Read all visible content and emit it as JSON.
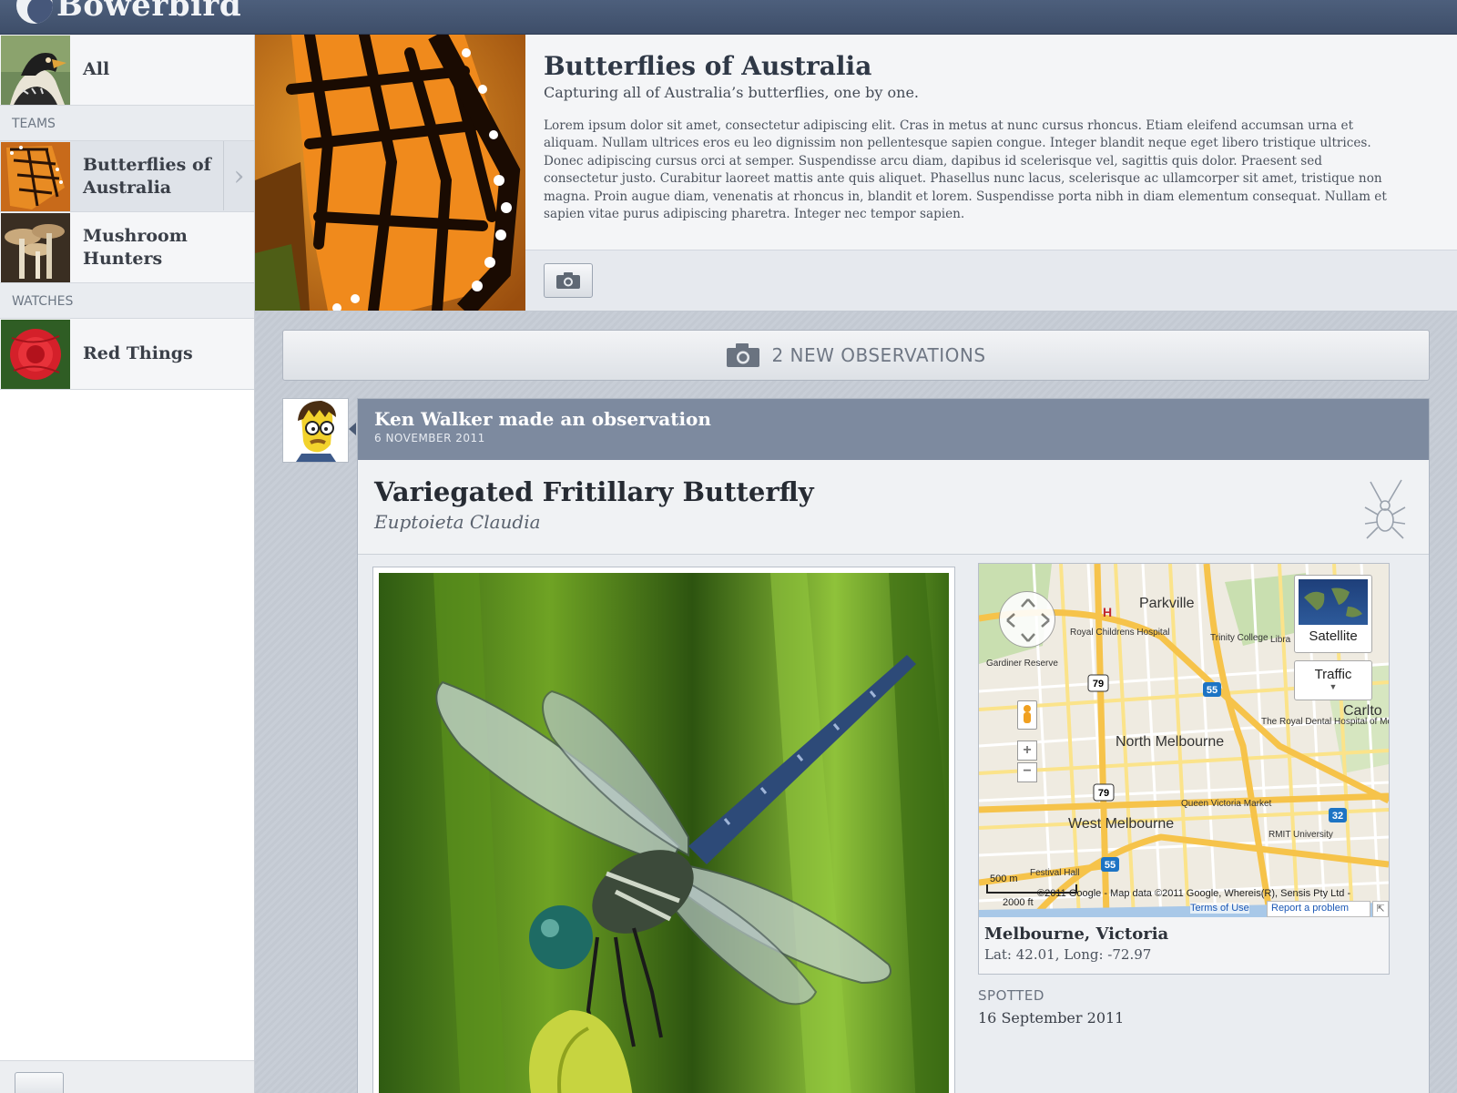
{
  "app": {
    "title": "Bowerbird"
  },
  "sidebar": {
    "all_label": "All",
    "teams_header": "TEAMS",
    "teams": [
      {
        "label": "Butterflies of Australia",
        "active": true
      },
      {
        "label": "Mushroom Hunters",
        "active": false
      }
    ],
    "watches_header": "WATCHES",
    "watches": [
      {
        "label": "Red Things"
      }
    ]
  },
  "team": {
    "title": "Butterflies of Australia",
    "subtitle": "Capturing all of Australia’s butterflies, one by one.",
    "description": "Lorem ipsum dolor sit amet, consectetur adipiscing elit. Cras in metus at nunc cursus rhoncus. Etiam eleifend accumsan urna et aliquam. Nullam ultrices eros eu leo dignissim non pellentesque sapien congue. Integer blandit neque eget libero tristique ultrices. Donec adipiscing cursus orci at semper. Suspendisse arcu diam, dapibus id scelerisque vel, sagittis quis dolor. Praesent sed consectetur justo. Curabitur laoreet mattis ante quis aliquet. Phasellus nunc lacus, scelerisque ac ullamcorper sit amet, tristique non magna. Proin augue diam, venenatis at rhoncus in, blandit et lorem. Suspendisse porta nibh in diam elementum consequat. Nullam et sapien vitae purus adipiscing pharetra. Integer nec tempor sapien."
  },
  "feed": {
    "new_observations": "2 NEW OBSERVATIONS",
    "observation": {
      "author_line": "Ken Walker made an observation",
      "date": "6 NOVEMBER 2011",
      "common_name": "Variegated Fritillary Butterfly",
      "scientific_name": "Euptoieta Claudia",
      "location": {
        "place": "Melbourne, Victoria",
        "coords": "Lat: 42.01, Long: -72.97"
      },
      "spotted_label": "SPOTTED",
      "spotted_date": "16 September 2011"
    }
  },
  "map": {
    "satellite_label": "Satellite",
    "traffic_label": "Traffic",
    "labels": {
      "parkville": "Parkville",
      "north_melbourne": "North Melbourne",
      "west_melbourne": "West Melbourne",
      "carlton": "Carlto",
      "royal_childrens": "Royal Childrens Hospital",
      "trinity": "Trinity College",
      "dental": "The Royal Dental Hospital of Melbourne",
      "queen_victoria": "Queen Victoria Market",
      "rmit": "RMIT University",
      "festival": "Festival Hall",
      "gardiner": "Gardiner Reserve",
      "libra": "Libra"
    },
    "scale_m": "500 m",
    "scale_ft": "2000 ft",
    "attribution": "©2011 Google - Map data ©2011 Google, Whereis(R), Sensis Pty Ltd -",
    "terms": "Terms of Use",
    "report": "Report a problem",
    "route_badges": [
      "79",
      "79",
      "55",
      "55",
      "32"
    ]
  },
  "colors": {
    "topbar": "#46577a",
    "obs_header": "#7d8a9f",
    "map_road": "#f6c34a"
  }
}
